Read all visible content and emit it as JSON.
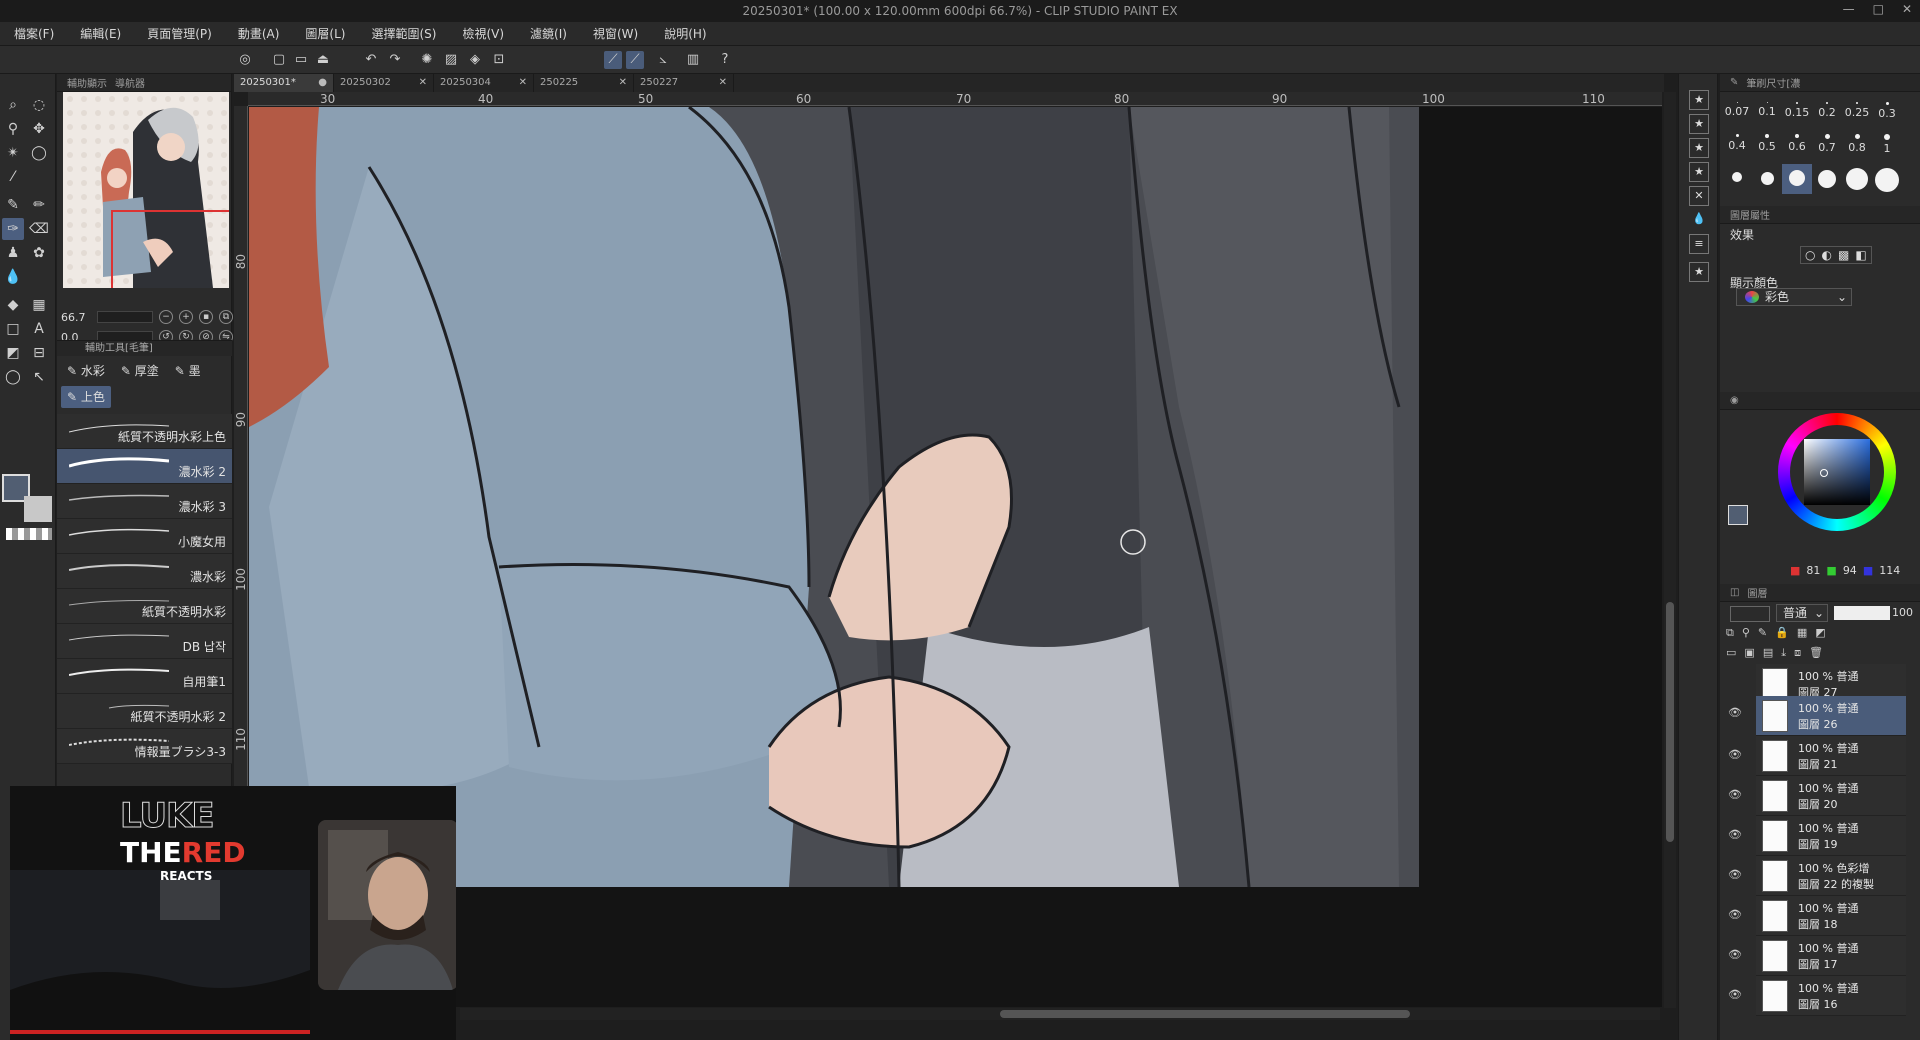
{
  "window": {
    "title": "20250301* (100.00 x 120.00mm 600dpi 66.7%) - CLIP STUDIO PAINT EX",
    "controls": [
      "—",
      "□",
      "✕"
    ]
  },
  "menu": [
    "檔案(F)",
    "編輯(E)",
    "頁面管理(P)",
    "動畫(A)",
    "圖層(L)",
    "選擇範圍(S)",
    "檢視(V)",
    "濾鏡(I)",
    "視窗(W)",
    "說明(H)"
  ],
  "doc_tabs": [
    {
      "label": "20250301*",
      "active": true
    },
    {
      "label": "20250302",
      "active": false
    },
    {
      "label": "20250304",
      "active": false
    },
    {
      "label": "250225",
      "active": false
    },
    {
      "label": "250227",
      "active": false
    }
  ],
  "navigator": {
    "tab1": "輔助顯示",
    "tab2": "導航器",
    "zoom": "66.7",
    "rotation": "0.0"
  },
  "subtool": {
    "header": "輔助工具[毛筆]",
    "tabs": [
      "水彩",
      "厚塗",
      "墨",
      "上色"
    ],
    "brushes": [
      {
        "name": "紙質不透明水彩上色",
        "active": false
      },
      {
        "name": "濃水彩 2",
        "active": true
      },
      {
        "name": "濃水彩 3",
        "active": false
      },
      {
        "name": "小魔女用",
        "active": false
      },
      {
        "name": "濃水彩",
        "active": false
      },
      {
        "name": "紙質不透明水彩",
        "active": false
      },
      {
        "name": "DB 납작",
        "active": false
      },
      {
        "name": "自用筆1",
        "active": false
      },
      {
        "name": "紙質不透明水彩 2",
        "active": false
      },
      {
        "name": "情報量ブラシ3-3",
        "active": false
      }
    ]
  },
  "rulers": {
    "h": [
      "30",
      "40",
      "50",
      "60",
      "70",
      "80",
      "90",
      "100",
      "110"
    ],
    "v": [
      "80",
      "90",
      "100",
      "110"
    ]
  },
  "brush_size": {
    "header": "筆刷尺寸[濃",
    "sizes": [
      "0.07",
      "0.1",
      "0.15",
      "0.2",
      "0.25",
      "0.3",
      "0.4",
      "0.5",
      "0.6",
      "0.7",
      "0.8",
      "1"
    ],
    "selected_index": 14
  },
  "layer_props": {
    "header": "圖層屬性",
    "effect_label": "效果",
    "display_color_label": "顯示顏色",
    "display_color_value": "彩色"
  },
  "color": {
    "r": "81",
    "g": "94",
    "b": "114",
    "main_hex": "#515e72"
  },
  "layers": {
    "header": "圖層",
    "blend_mode": "普通",
    "opacity": "100",
    "items": [
      {
        "line1": "100 % 普通",
        "line2": "圖層 27",
        "selected": false
      },
      {
        "line1": "100 % 普通",
        "line2": "圖層 26",
        "selected": true
      },
      {
        "line1": "100 % 普通",
        "line2": "圖層 21",
        "selected": false
      },
      {
        "line1": "100 % 普通",
        "line2": "圖層 20",
        "selected": false
      },
      {
        "line1": "100 % 普通",
        "line2": "圖層 19",
        "selected": false
      },
      {
        "line1": "100 % 色彩增",
        "line2": "圖層 22 的複製",
        "selected": false
      },
      {
        "line1": "100 % 普通",
        "line2": "圖層 18",
        "selected": false
      },
      {
        "line1": "100 % 普通",
        "line2": "圖層 17",
        "selected": false
      },
      {
        "line1": "100 % 普通",
        "line2": "圖層 16",
        "selected": false
      }
    ]
  },
  "overlay": {
    "brand1": "LUKE",
    "brand2a": "THE",
    "brand2b": "RED",
    "brand3": "REACTS"
  }
}
